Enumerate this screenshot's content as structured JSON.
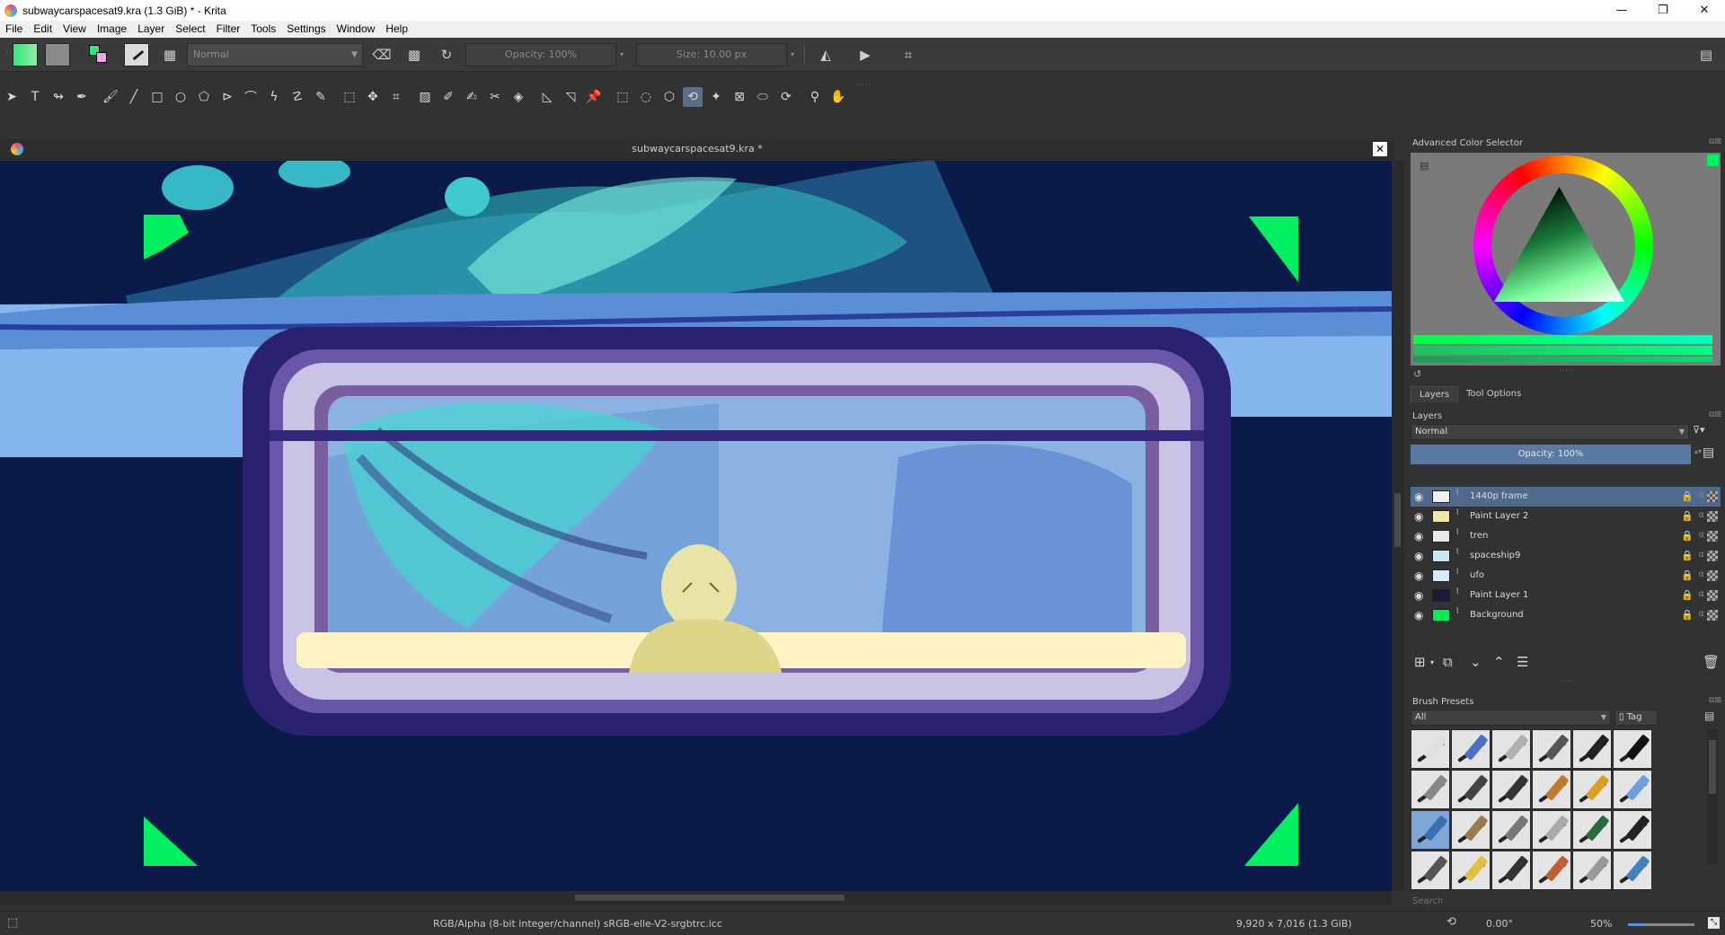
{
  "window": {
    "title": "subwaycarspacesat9.kra (1.3 GiB)  * - Krita",
    "minimize": "—",
    "restore": "❐",
    "close": "✕"
  },
  "menu": [
    "File",
    "Edit",
    "View",
    "Image",
    "Layer",
    "Select",
    "Filter",
    "Tools",
    "Settings",
    "Window",
    "Help"
  ],
  "toolbar": {
    "blend_mode": "Normal",
    "opacity": "Opacity: 100%",
    "size": "Size: 10.00 px",
    "colors": {
      "foreground": "#2ee87a",
      "background": "#8a8a8a"
    }
  },
  "document": {
    "tab_title": "subwaycarspacesat9.kra *",
    "close": "✕"
  },
  "dockers": {
    "color_selector_title": "Advanced Color Selector",
    "tabs": [
      "Layers",
      "Tool Options"
    ],
    "layers_title": "Layers",
    "layers_blend": "Normal",
    "layers_opacity": "Opacity:  100%",
    "layers": [
      {
        "name": "1440p frame",
        "active": true,
        "thumb": "#f0f0f0"
      },
      {
        "name": "Paint Layer 2",
        "active": false,
        "thumb": "#f2e6a6"
      },
      {
        "name": "tren",
        "active": false,
        "thumb": "#e8e8e8"
      },
      {
        "name": "spaceship9",
        "active": false,
        "thumb": "#c8e6f2"
      },
      {
        "name": "ufo",
        "active": false,
        "thumb": "#d8e8ff"
      },
      {
        "name": "Paint Layer 1",
        "active": false,
        "thumb": "#1a1a3a"
      },
      {
        "name": "Background",
        "active": false,
        "thumb": "#00ee55"
      }
    ],
    "brush_presets_title": "Brush Presets",
    "brush_filter": "All",
    "brush_tag": "Tag",
    "search_placeholder": "Search"
  },
  "status": {
    "color_space": "RGB/Alpha (8-bit integer/channel)  sRGB-elle-V2-srgbtrc.icc",
    "dimensions": "9,920 x 7,016 (1.3 GiB)",
    "rotation": "0.00°",
    "zoom": "50%"
  }
}
